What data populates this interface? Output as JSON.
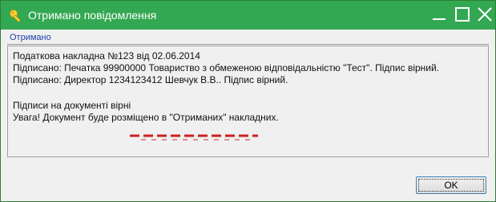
{
  "window": {
    "title": "Отримано повідомлення",
    "title_icon": "key-icon",
    "controls": [
      "minimize-icon",
      "maximize-icon",
      "close-icon"
    ],
    "title_color": "#33a852"
  },
  "section": {
    "label": "Отримано"
  },
  "message": {
    "lines": [
      "Податкова накладна  №123 від 02.06.2014",
      "Підписано: Печатка 99900000 Товариство з обмеженою відповідальністю \"Тест\". Підпис вірний.",
      "Підписано: Директор 1234123412 Шевчук В.В.. Підпис вірний.",
      "",
      "Підписи на документі вірні",
      "Увага! Документ буде розміщено в \"Отриманих\" накладних."
    ],
    "highlight_color": "#cc2020"
  },
  "buttons": {
    "ok_label": "OK"
  }
}
